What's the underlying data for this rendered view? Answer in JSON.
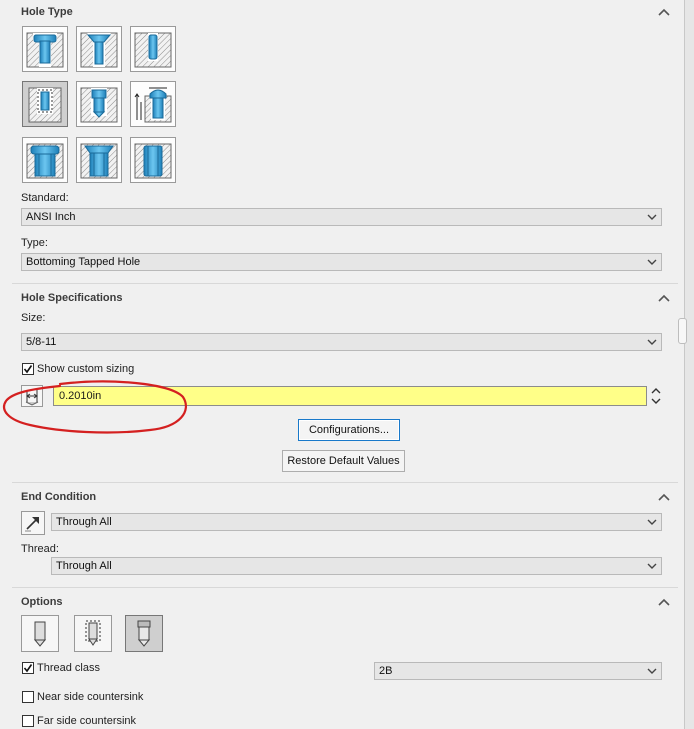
{
  "hole_type": {
    "title": "Hole Type",
    "tiles": [
      {
        "name": "counterbore-icon"
      },
      {
        "name": "countersink-icon"
      },
      {
        "name": "hole-icon"
      },
      {
        "name": "straight-tap-icon"
      },
      {
        "name": "tapered-tap-icon"
      },
      {
        "name": "legacy-hole-icon"
      },
      {
        "name": "counterbore-slot-icon"
      },
      {
        "name": "countersink-slot-icon"
      },
      {
        "name": "slot-icon"
      }
    ],
    "selected_index": 3,
    "standard_label": "Standard:",
    "standard_value": "ANSI Inch",
    "type_label": "Type:",
    "type_value": "Bottoming Tapped Hole"
  },
  "hole_spec": {
    "title": "Hole Specifications",
    "size_label": "Size:",
    "size_value": "5/8-11",
    "custom_sizing_label": "Show custom sizing",
    "custom_sizing_checked": true,
    "diameter_value": "0.2010in",
    "configurations_label": "Configurations...",
    "restore_label": "Restore Default Values"
  },
  "end_condition": {
    "title": "End Condition",
    "value": "Through All",
    "thread_label": "Thread:",
    "thread_value": "Through All"
  },
  "options": {
    "title": "Options",
    "thread_class_label": "Thread class",
    "thread_class_checked": true,
    "thread_class_value": "2B",
    "near_side_label": "Near side countersink",
    "far_side_label": "Far side countersink"
  },
  "colors": {
    "highlight_field": "#ffff88",
    "annotation": "#d42020",
    "hole_blue": "#3ea6dc"
  }
}
